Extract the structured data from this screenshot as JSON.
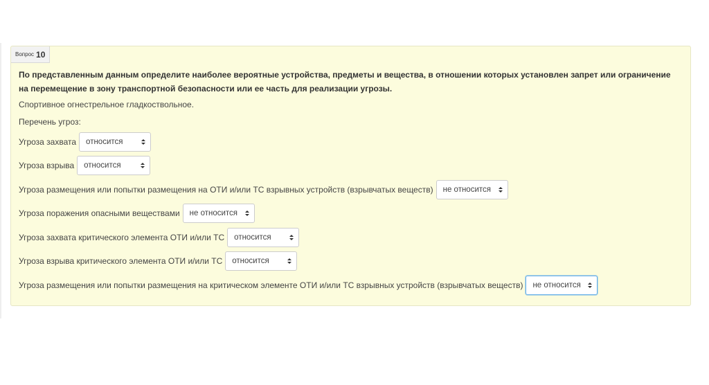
{
  "question": {
    "prefix": "Вопрос",
    "number": "10",
    "text": "По представленным данным определите наиболее вероятные устройства, предметы и вещества, в отношении которых установлен запрет или ограничение на перемещение в зону транспортной безопасности или ее часть для реализации угрозы.",
    "item": "Спортивное огнестрельное гладкоствольное.",
    "list_title": "Перечень угроз:"
  },
  "threats": [
    {
      "label": "Угроза захвата",
      "value": "относится"
    },
    {
      "label": "Угроза взрыва",
      "value": "относится"
    },
    {
      "label": "Угроза размещения или попытки размещения на ОТИ и/или ТС взрывных устройств (взрывчатых веществ)",
      "value": "не относится"
    },
    {
      "label": "Угроза поражения опасными веществами",
      "value": "не относится"
    },
    {
      "label": "Угроза захвата критического элемента ОТИ и/или ТС",
      "value": "относится"
    },
    {
      "label": "Угроза взрыва критического элемента ОТИ и/или ТС",
      "value": "относится"
    },
    {
      "label": "Угроза размещения или попытки размещения на критическом элементе ОТИ и/или ТС взрывных устройств (взрывчатых веществ)",
      "value": "не относится"
    }
  ]
}
